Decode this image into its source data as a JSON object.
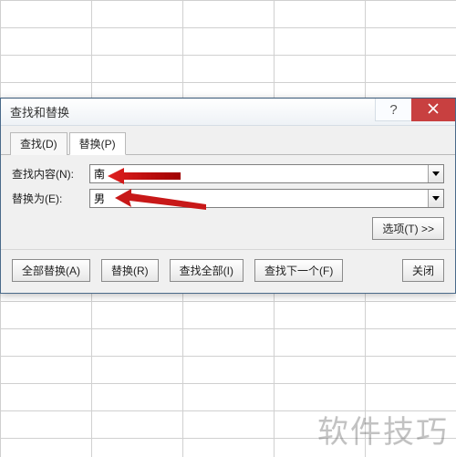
{
  "dialog": {
    "title": "查找和替换",
    "tabs": {
      "find": "查找(D)",
      "replace": "替换(P)"
    },
    "fields": {
      "find_label": "查找内容(N):",
      "find_value": "南",
      "replace_label": "替换为(E):",
      "replace_value": "男"
    },
    "options_btn": "选项(T) >>",
    "buttons": {
      "replace_all": "全部替换(A)",
      "replace": "替换(R)",
      "find_all": "查找全部(I)",
      "find_next": "查找下一个(F)",
      "close": "关闭"
    },
    "help_glyph": "?"
  },
  "watermark": "软件技巧"
}
